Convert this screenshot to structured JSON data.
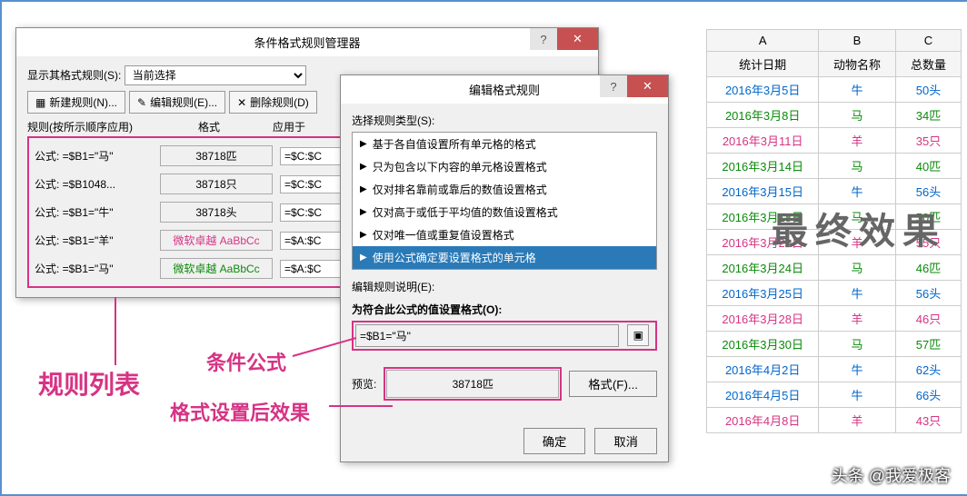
{
  "manager": {
    "title": "条件格式规则管理器",
    "show_rules_label": "显示其格式规则(S):",
    "scope": "当前选择",
    "btn_new": "新建规则(N)...",
    "btn_edit": "编辑规则(E)...",
    "btn_delete": "删除规则(D)",
    "col_rule": "规则(按所示顺序应用)",
    "col_format": "格式",
    "col_applies": "应用于",
    "rules": [
      {
        "formula": "公式: =$B1=\"马\"",
        "format": "38718匹",
        "applies": "=$C:$C",
        "cls": ""
      },
      {
        "formula": "公式: =$B1048...",
        "format": "38718只",
        "applies": "=$C:$C",
        "cls": ""
      },
      {
        "formula": "公式: =$B1=\"牛\"",
        "format": "38718头",
        "applies": "=$C:$C",
        "cls": ""
      },
      {
        "formula": "公式: =$B1=\"羊\"",
        "format": "微软卓越 AaBbCc",
        "applies": "=$A:$C",
        "cls": "pink-text"
      },
      {
        "formula": "公式: =$B1=\"马\"",
        "format": "微软卓越 AaBbCc",
        "applies": "=$A:$C",
        "cls": "green-text"
      }
    ]
  },
  "editor": {
    "title": "编辑格式规则",
    "select_type_label": "选择规则类型(S):",
    "types": [
      "基于各自值设置所有单元格的格式",
      "只为包含以下内容的单元格设置格式",
      "仅对排名靠前或靠后的数值设置格式",
      "仅对高于或低于平均值的数值设置格式",
      "仅对唯一值或重复值设置格式",
      "使用公式确定要设置格式的单元格"
    ],
    "type_selected": 5,
    "edit_desc_label": "编辑规则说明(E):",
    "formula_label": "为符合此公式的值设置格式(O):",
    "formula_value": "=$B1=\"马\"",
    "preview_label": "预览:",
    "preview_value": "38718匹",
    "format_btn": "格式(F)...",
    "ok": "确定",
    "cancel": "取消"
  },
  "annotations": {
    "rules_list": "规则列表",
    "cond_formula": "条件公式",
    "format_effect": "格式设置后效果",
    "final_effect": "最终效果"
  },
  "grid": {
    "cols": [
      "A",
      "B",
      "C"
    ],
    "headers": [
      "统计日期",
      "动物名称",
      "总数量"
    ],
    "rows": [
      {
        "d": "2016年3月5日",
        "a": "牛",
        "q": "50头",
        "cls": "blue-text"
      },
      {
        "d": "2016年3月8日",
        "a": "马",
        "q": "34匹",
        "cls": "green-text"
      },
      {
        "d": "2016年3月11日",
        "a": "羊",
        "q": "35只",
        "cls": "pink-text"
      },
      {
        "d": "2016年3月14日",
        "a": "马",
        "q": "40匹",
        "cls": "green-text"
      },
      {
        "d": "2016年3月15日",
        "a": "牛",
        "q": "56头",
        "cls": "blue-text"
      },
      {
        "d": "2016年3月18日",
        "a": "马",
        "q": "50匹",
        "cls": "green-text"
      },
      {
        "d": "2016年3月21日",
        "a": "羊",
        "q": "55只",
        "cls": "pink-text"
      },
      {
        "d": "2016年3月24日",
        "a": "马",
        "q": "46匹",
        "cls": "green-text"
      },
      {
        "d": "2016年3月25日",
        "a": "牛",
        "q": "56头",
        "cls": "blue-text"
      },
      {
        "d": "2016年3月28日",
        "a": "羊",
        "q": "46只",
        "cls": "pink-text"
      },
      {
        "d": "2016年3月30日",
        "a": "马",
        "q": "57匹",
        "cls": "green-text"
      },
      {
        "d": "2016年4月2日",
        "a": "牛",
        "q": "62头",
        "cls": "blue-text"
      },
      {
        "d": "2016年4月5日",
        "a": "牛",
        "q": "66头",
        "cls": "blue-text"
      },
      {
        "d": "2016年4月8日",
        "a": "羊",
        "q": "43只",
        "cls": "pink-text"
      }
    ]
  },
  "watermark": "头条 @我爱极客"
}
